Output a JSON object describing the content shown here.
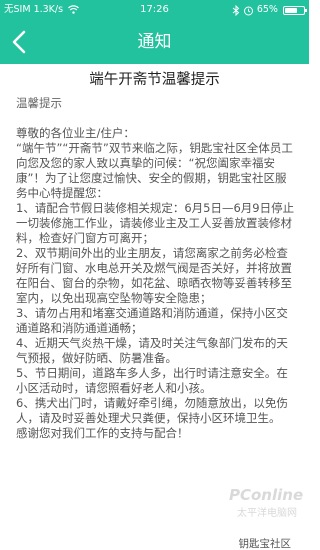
{
  "status_bar": {
    "carrier": "无SIM",
    "network_speed": "1.3K/s",
    "time": "17:26",
    "battery_percent": "65%",
    "battery_level": 0.65
  },
  "header": {
    "title": "通知",
    "back_icon": "chevron-left-icon"
  },
  "article": {
    "title": "端午开斋节温馨提示",
    "greeting_label": "温馨提示",
    "paragraphs": [
      "尊敬的各位业主/住户：",
      "“端午节”“开斋节”双节来临之际，钥匙宝社区全体员工向您及您的家人致以真挚的问候：“祝您阖家幸福安康”！为了让您度过愉快、安全的假期，钥匙宝社区服务中心特提醒您：",
      "1、请配合节假日装修相关规定：6月5日—6月9日停止一切装修施工作业，请装修业主及工人妥善放置装修材料，检查好门窗方可离开；",
      "2、双节期间外出的业主朋友，请您离家之前务必检查好所有门窗、水电总开关及燃气阀是否关好，并将放置在阳台、窗台的杂物，如花盆、晾晒衣物等妥善转移至室内，以免出现高空坠物等安全隐患；",
      "3、请勿占用和堵塞交通道路和消防通道，保持小区交通道路和消防通道通畅；",
      "4、近期天气炎热干燥，请及时关注气象部门发布的天气预报，做好防晒、防暑准备。",
      "5、节日期间，道路车多人多，出行时请注意安全。在小区活动时，请您照看好老人和小孩。",
      "6、携犬出门时，请戴好牵引绳，勿随意放出，以免伤人，请及时妥善处理犬只粪便，保持小区环境卫生。",
      "感谢您对我们工作的支持与配合！"
    ],
    "signature": "钥匙宝社区"
  },
  "watermark": {
    "text": "PConline",
    "subtext": "太平洋电脑网"
  },
  "colors": {
    "header_background": "#23c29f",
    "header_text": "#ffffff",
    "title_text": "#222222",
    "body_text": "#555555"
  }
}
